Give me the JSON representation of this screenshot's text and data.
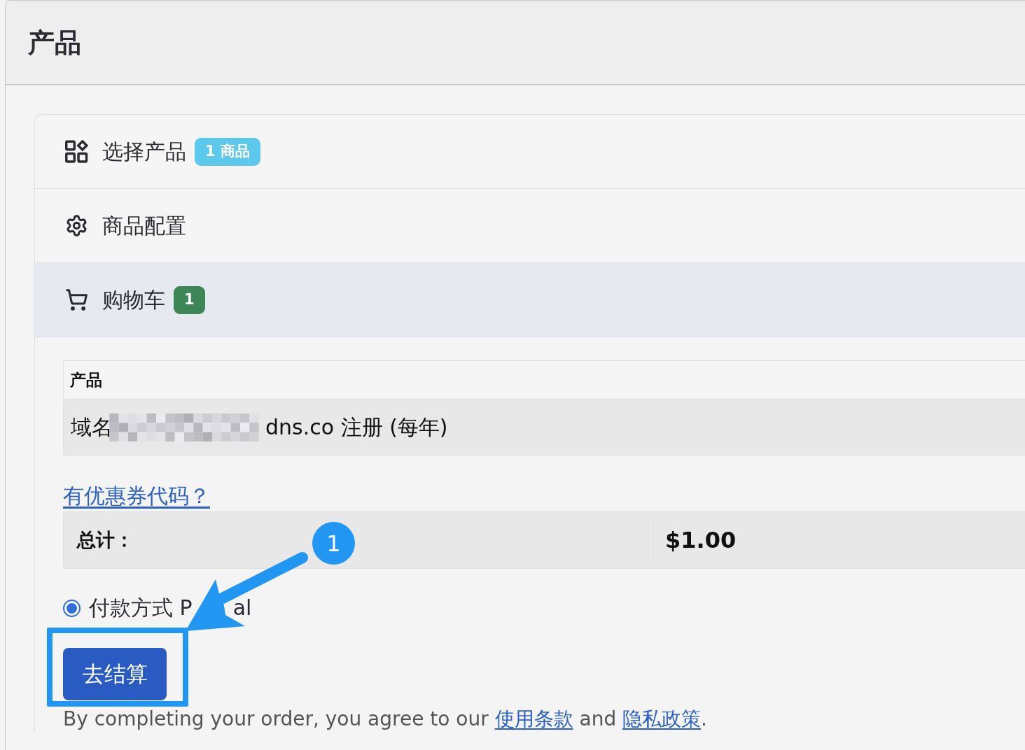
{
  "page": {
    "title": "产品"
  },
  "steps": [
    {
      "kind": "products",
      "label": "选择产品",
      "selected": false,
      "badge": {
        "text": "1 商品",
        "color": "#5bc8ec"
      }
    },
    {
      "kind": "config",
      "label": "商品配置",
      "selected": false
    },
    {
      "kind": "cart",
      "label": "购物车",
      "selected": true,
      "badge": {
        "text": "1",
        "color": "#3c8658"
      }
    }
  ],
  "cart_table": {
    "columns": [
      "产品"
    ],
    "rows": [
      {
        "prefix": "域名",
        "redacted": true,
        "suffix": "dns.co 注册 (每年)"
      }
    ]
  },
  "coupon_link": "有优惠券代码？",
  "totals": {
    "label": "总计：",
    "value": "$1.00"
  },
  "payment": {
    "selected": true,
    "label_parts": [
      "付款方式 P",
      "al"
    ]
  },
  "checkout_button": "去结算",
  "agreement": [
    {
      "kind": "text",
      "text": "By completing your order, you agree to our "
    },
    {
      "kind": "link",
      "text": "使用条款"
    },
    {
      "kind": "text",
      "text": " and "
    },
    {
      "kind": "link",
      "text": "隐私政策"
    },
    {
      "kind": "text",
      "text": "."
    }
  ],
  "callout": {
    "number": "1"
  }
}
